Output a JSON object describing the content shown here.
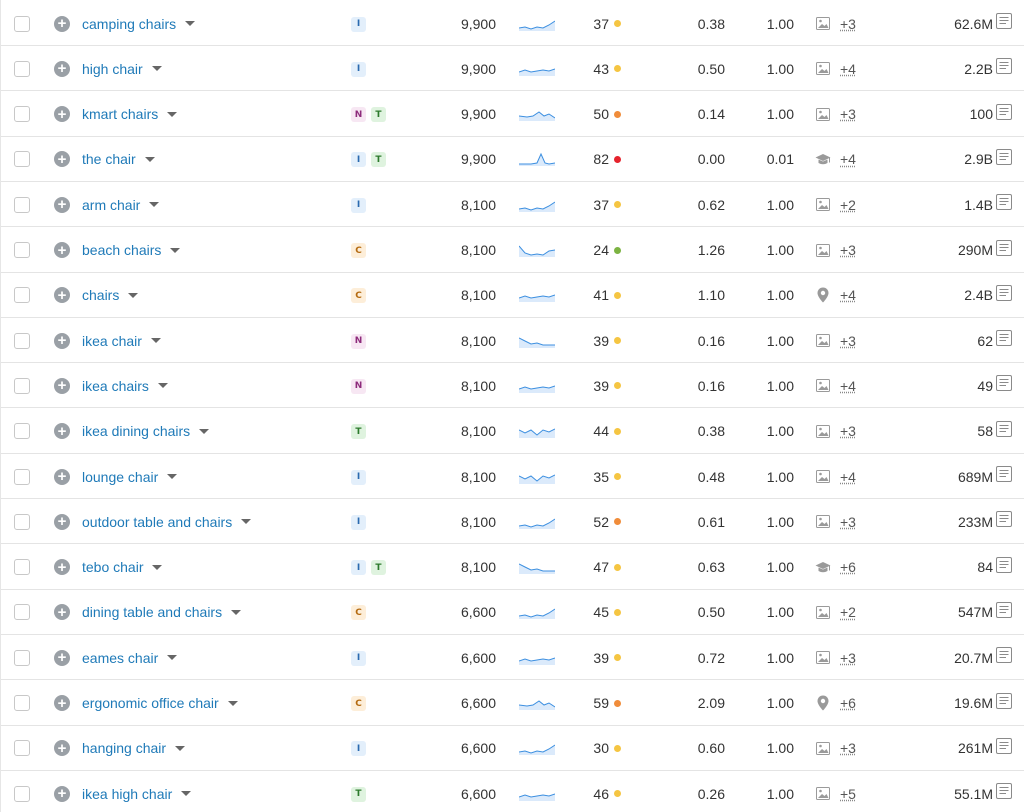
{
  "colors": {
    "link": "#1f7ab8",
    "kd_yellow": "#f5c542",
    "kd_orange": "#f08c3a",
    "kd_red": "#e5232d",
    "kd_green": "#7cb342"
  },
  "rows": [
    {
      "keyword": "camping chairs",
      "intents": [
        "I"
      ],
      "volume": "9,900",
      "trend": "up",
      "kd": "37",
      "kd_level": "yellow",
      "cpc": "0.38",
      "competition": "1.00",
      "serp_icon": "image-icon",
      "serp_extra": "+3",
      "results": "62.6M"
    },
    {
      "keyword": "high chair",
      "intents": [
        "I"
      ],
      "volume": "9,900",
      "trend": "flat",
      "kd": "43",
      "kd_level": "yellow",
      "cpc": "0.50",
      "competition": "1.00",
      "serp_icon": "image-icon",
      "serp_extra": "+4",
      "results": "2.2B"
    },
    {
      "keyword": "kmart chairs",
      "intents": [
        "N",
        "T"
      ],
      "volume": "9,900",
      "trend": "bump",
      "kd": "50",
      "kd_level": "orange",
      "cpc": "0.14",
      "competition": "1.00",
      "serp_icon": "image-icon",
      "serp_extra": "+3",
      "results": "100"
    },
    {
      "keyword": "the chair",
      "intents": [
        "I",
        "T"
      ],
      "volume": "9,900",
      "trend": "spike",
      "kd": "82",
      "kd_level": "red",
      "cpc": "0.00",
      "competition": "0.01",
      "serp_icon": "graduation-cap-icon",
      "serp_extra": "+4",
      "results": "2.9B"
    },
    {
      "keyword": "arm chair",
      "intents": [
        "I"
      ],
      "volume": "8,100",
      "trend": "up",
      "kd": "37",
      "kd_level": "yellow",
      "cpc": "0.62",
      "competition": "1.00",
      "serp_icon": "image-icon",
      "serp_extra": "+2",
      "results": "1.4B"
    },
    {
      "keyword": "beach chairs",
      "intents": [
        "C"
      ],
      "volume": "8,100",
      "trend": "dip",
      "kd": "24",
      "kd_level": "green",
      "cpc": "1.26",
      "competition": "1.00",
      "serp_icon": "image-icon",
      "serp_extra": "+3",
      "results": "290M"
    },
    {
      "keyword": "chairs",
      "intents": [
        "C"
      ],
      "volume": "8,100",
      "trend": "flat",
      "kd": "41",
      "kd_level": "yellow",
      "cpc": "1.10",
      "competition": "1.00",
      "serp_icon": "map-pin-icon",
      "serp_extra": "+4",
      "results": "2.4B"
    },
    {
      "keyword": "ikea chair",
      "intents": [
        "N"
      ],
      "volume": "8,100",
      "trend": "down",
      "kd": "39",
      "kd_level": "yellow",
      "cpc": "0.16",
      "competition": "1.00",
      "serp_icon": "image-icon",
      "serp_extra": "+3",
      "results": "62"
    },
    {
      "keyword": "ikea chairs",
      "intents": [
        "N"
      ],
      "volume": "8,100",
      "trend": "flat",
      "kd": "39",
      "kd_level": "yellow",
      "cpc": "0.16",
      "competition": "1.00",
      "serp_icon": "image-icon",
      "serp_extra": "+4",
      "results": "49"
    },
    {
      "keyword": "ikea dining chairs",
      "intents": [
        "T"
      ],
      "volume": "8,100",
      "trend": "wave",
      "kd": "44",
      "kd_level": "yellow",
      "cpc": "0.38",
      "competition": "1.00",
      "serp_icon": "image-icon",
      "serp_extra": "+3",
      "results": "58"
    },
    {
      "keyword": "lounge chair",
      "intents": [
        "I"
      ],
      "volume": "8,100",
      "trend": "wave",
      "kd": "35",
      "kd_level": "yellow",
      "cpc": "0.48",
      "competition": "1.00",
      "serp_icon": "image-icon",
      "serp_extra": "+4",
      "results": "689M"
    },
    {
      "keyword": "outdoor table and chairs",
      "intents": [
        "I"
      ],
      "volume": "8,100",
      "trend": "up",
      "kd": "52",
      "kd_level": "orange",
      "cpc": "0.61",
      "competition": "1.00",
      "serp_icon": "image-icon",
      "serp_extra": "+3",
      "results": "233M"
    },
    {
      "keyword": "tebo chair",
      "intents": [
        "I",
        "T"
      ],
      "volume": "8,100",
      "trend": "down",
      "kd": "47",
      "kd_level": "yellow",
      "cpc": "0.63",
      "competition": "1.00",
      "serp_icon": "graduation-cap-icon",
      "serp_extra": "+6",
      "results": "84"
    },
    {
      "keyword": "dining table and chairs",
      "intents": [
        "C"
      ],
      "volume": "6,600",
      "trend": "up",
      "kd": "45",
      "kd_level": "yellow",
      "cpc": "0.50",
      "competition": "1.00",
      "serp_icon": "image-icon",
      "serp_extra": "+2",
      "results": "547M"
    },
    {
      "keyword": "eames chair",
      "intents": [
        "I"
      ],
      "volume": "6,600",
      "trend": "flat",
      "kd": "39",
      "kd_level": "yellow",
      "cpc": "0.72",
      "competition": "1.00",
      "serp_icon": "image-icon",
      "serp_extra": "+3",
      "results": "20.7M"
    },
    {
      "keyword": "ergonomic office chair",
      "intents": [
        "C"
      ],
      "volume": "6,600",
      "trend": "bump",
      "kd": "59",
      "kd_level": "orange",
      "cpc": "2.09",
      "competition": "1.00",
      "serp_icon": "map-pin-icon",
      "serp_extra": "+6",
      "results": "19.6M"
    },
    {
      "keyword": "hanging chair",
      "intents": [
        "I"
      ],
      "volume": "6,600",
      "trend": "up",
      "kd": "30",
      "kd_level": "yellow",
      "cpc": "0.60",
      "competition": "1.00",
      "serp_icon": "image-icon",
      "serp_extra": "+3",
      "results": "261M"
    },
    {
      "keyword": "ikea high chair",
      "intents": [
        "T"
      ],
      "volume": "6,600",
      "trend": "flat",
      "kd": "46",
      "kd_level": "yellow",
      "cpc": "0.26",
      "competition": "1.00",
      "serp_icon": "image-icon",
      "serp_extra": "+5",
      "results": "55.1M"
    }
  ]
}
